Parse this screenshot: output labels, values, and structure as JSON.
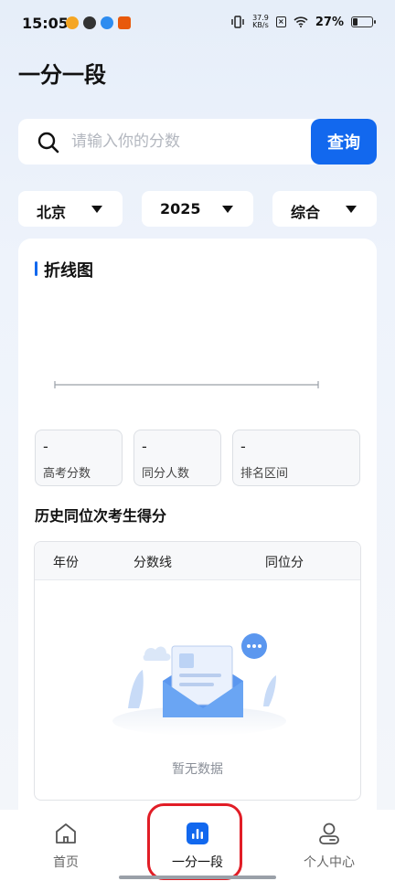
{
  "status_bar": {
    "time": "15:05",
    "net_speed_value": "37.9",
    "net_speed_unit": "KB/s",
    "battery": "27%",
    "battery_level": 0.27
  },
  "page": {
    "title": "一分一段"
  },
  "search": {
    "placeholder": "请输入你的分数",
    "value": "",
    "button_label": "查询"
  },
  "filters": [
    {
      "label": "北京"
    },
    {
      "label": "2025"
    },
    {
      "label": "综合"
    }
  ],
  "chart": {
    "section_title": "折线图"
  },
  "stats": [
    {
      "value": "-",
      "label": "高考分数"
    },
    {
      "value": "-",
      "label": "同分人数"
    },
    {
      "value": "-",
      "label": "排名区间"
    }
  ],
  "history": {
    "title": "历史同位次考生得分",
    "columns": [
      "年份",
      "分数线",
      "同位分"
    ],
    "rows": [],
    "empty_text": "暂无数据"
  },
  "bottom_nav": [
    {
      "label": "首页",
      "icon": "home-icon"
    },
    {
      "label": "一分一段",
      "icon": "bar-chart-icon",
      "active": true
    },
    {
      "label": "个人中心",
      "icon": "user-icon"
    }
  ],
  "colors": {
    "accent": "#1268ee",
    "highlight": "#e11d26"
  }
}
